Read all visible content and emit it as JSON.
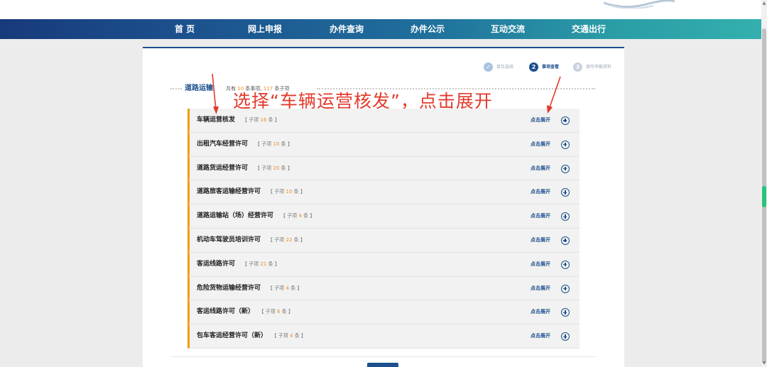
{
  "nav": {
    "items": [
      {
        "label": "首 页"
      },
      {
        "label": "网上申报"
      },
      {
        "label": "办件查询"
      },
      {
        "label": "办件公示"
      },
      {
        "label": "互动交流"
      },
      {
        "label": "交通出行"
      }
    ]
  },
  "steps": [
    {
      "number": "✓",
      "label": "单位选择",
      "state": "done",
      "color": "#a8c4e0"
    },
    {
      "number": "2",
      "label": "事项查看",
      "state": "current",
      "color": "#1c4f8c"
    },
    {
      "number": "3",
      "label": "填写申报资料",
      "state": "pending",
      "color": "#c9d2dc"
    }
  ],
  "section": {
    "title": "道路运输",
    "count_prefix": "共有",
    "item_count": "10",
    "count_mid": "条事项,",
    "sub_count": "117",
    "count_suffix": "条子项"
  },
  "annotation": {
    "text": "选择“车辆运营核发”，点击展开"
  },
  "list": {
    "expand_label": "点击展开",
    "sub_prefix": "【 子项",
    "sub_suffix": "条 】",
    "items": [
      {
        "name": "车辆运营核发",
        "count": "16"
      },
      {
        "name": "出租汽车经营许可",
        "count": "10"
      },
      {
        "name": "道路货运经营许可",
        "count": "20"
      },
      {
        "name": "道路旅客运输经营许可",
        "count": "10"
      },
      {
        "name": "道路运输站（场）经营许可",
        "count": "4"
      },
      {
        "name": "机动车驾驶员培训许可",
        "count": "22"
      },
      {
        "name": "客运线路许可",
        "count": "21"
      },
      {
        "name": "危险货物运输经营许可",
        "count": "4"
      },
      {
        "name": "客运线路许可（新）",
        "count": "6"
      },
      {
        "name": "包车客运经营许可（新）",
        "count": "4"
      }
    ]
  },
  "colors": {
    "accent": "#1c4f8c",
    "highlight_orange": "#f08a1c",
    "annotation_red": "#e23a2c"
  }
}
